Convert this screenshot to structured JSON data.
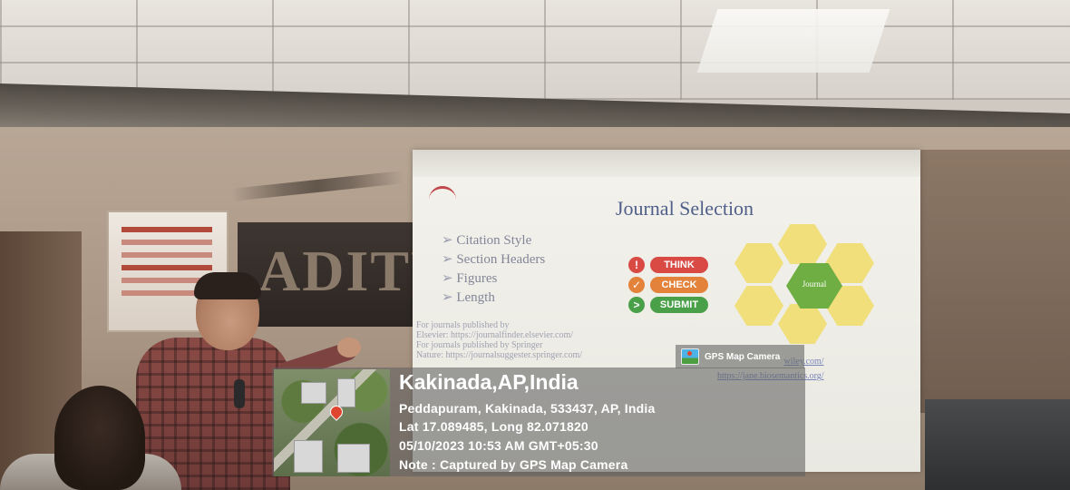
{
  "slide": {
    "title": "Journal Selection",
    "bullets": [
      "Citation Style",
      "Section Headers",
      "Figures",
      "Length"
    ],
    "tcs": [
      {
        "symbol": "!",
        "label": "THINK",
        "color": "#d94a44"
      },
      {
        "symbol": "✓",
        "label": "CHECK",
        "color": "#e3823a"
      },
      {
        "symbol": ">",
        "label": "SUBMIT",
        "color": "#4aa048"
      }
    ],
    "hex_center_label": "Journal",
    "references": [
      {
        "text": "For journals published by"
      },
      {
        "text": "Elsevier: https://journalfinder.elsevier.com/"
      },
      {
        "text": "For journals published by Springer"
      },
      {
        "text": "Nature: https://journalsuggester.springer.com/"
      }
    ],
    "references_right": [
      "wiley.com/",
      "https://jane.biosemantics.org/"
    ]
  },
  "banner": {
    "text": "ADITYA"
  },
  "gps_overlay": {
    "badge": "GPS Map Camera",
    "city": "Kakinada,AP,India",
    "address": "Peddapuram, Kakinada, 533437, AP, India",
    "coordinates": "Lat 17.089485, Long 82.071820",
    "datetime": "05/10/2023 10:53 AM GMT+05:30",
    "note": "Note : Captured by GPS Map Camera"
  }
}
